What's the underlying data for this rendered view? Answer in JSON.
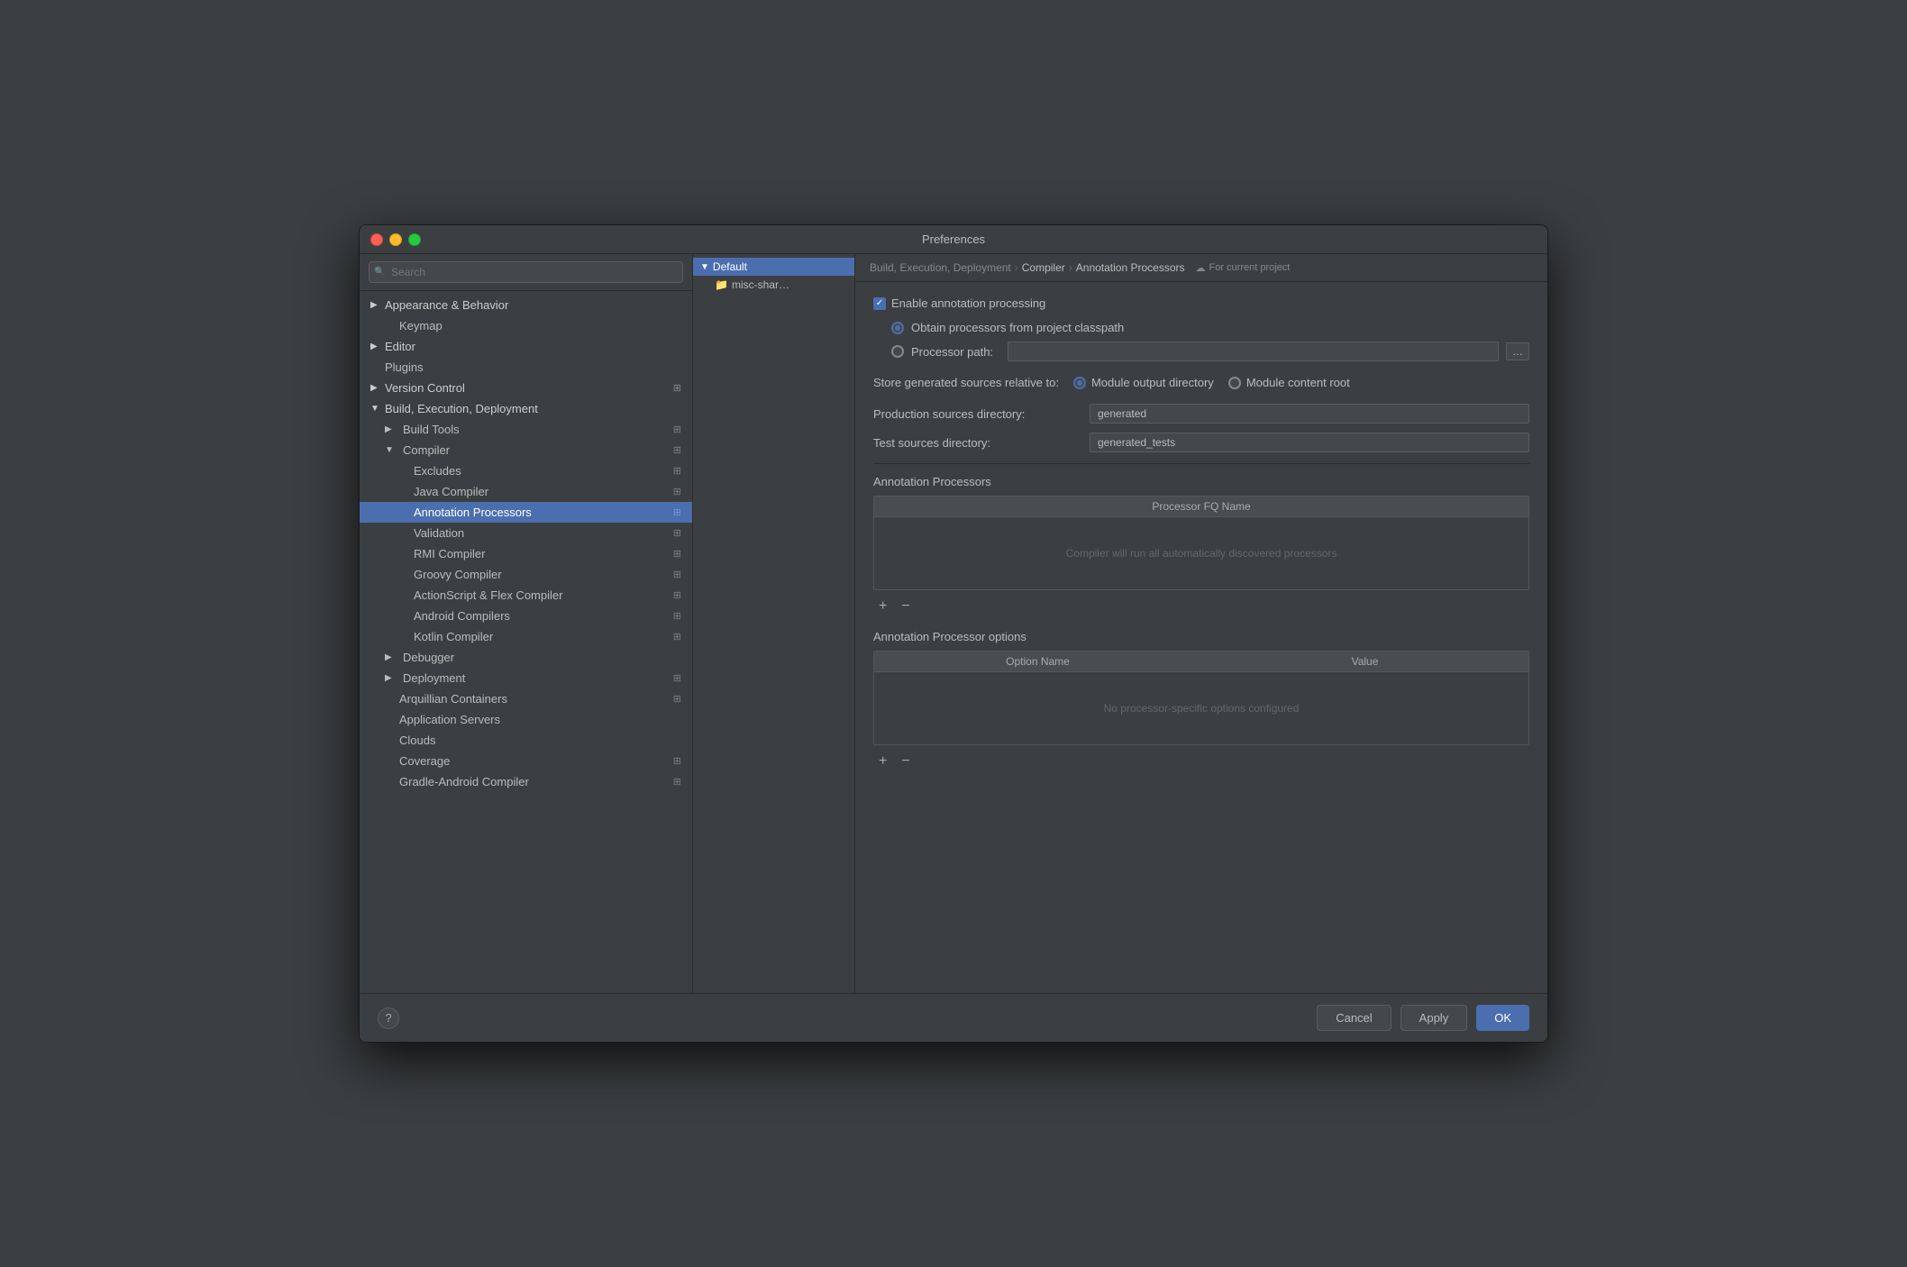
{
  "window": {
    "title": "Preferences"
  },
  "sidebar": {
    "search_placeholder": "Search",
    "items": [
      {
        "id": "appearance-behavior",
        "label": "Appearance & Behavior",
        "indent": 0,
        "arrow": "▶",
        "has_arrow": true,
        "active": false
      },
      {
        "id": "keymap",
        "label": "Keymap",
        "indent": 1,
        "has_arrow": false,
        "active": false
      },
      {
        "id": "editor",
        "label": "Editor",
        "indent": 0,
        "arrow": "▶",
        "has_arrow": true,
        "active": false
      },
      {
        "id": "plugins",
        "label": "Plugins",
        "indent": 0,
        "has_arrow": false,
        "active": false
      },
      {
        "id": "version-control",
        "label": "Version Control",
        "indent": 0,
        "arrow": "▶",
        "has_arrow": true,
        "active": false
      },
      {
        "id": "build-execution-deployment",
        "label": "Build, Execution, Deployment",
        "indent": 0,
        "arrow": "▼",
        "has_arrow": true,
        "active": false
      },
      {
        "id": "build-tools",
        "label": "Build Tools",
        "indent": 1,
        "arrow": "▶",
        "has_arrow": true,
        "active": false
      },
      {
        "id": "compiler",
        "label": "Compiler",
        "indent": 1,
        "arrow": "▼",
        "has_arrow": true,
        "active": false
      },
      {
        "id": "excludes",
        "label": "Excludes",
        "indent": 2,
        "has_arrow": false,
        "active": false
      },
      {
        "id": "java-compiler",
        "label": "Java Compiler",
        "indent": 2,
        "has_arrow": false,
        "active": false
      },
      {
        "id": "annotation-processors",
        "label": "Annotation Processors",
        "indent": 2,
        "has_arrow": false,
        "active": true
      },
      {
        "id": "validation",
        "label": "Validation",
        "indent": 2,
        "has_arrow": false,
        "active": false
      },
      {
        "id": "rmi-compiler",
        "label": "RMI Compiler",
        "indent": 2,
        "has_arrow": false,
        "active": false
      },
      {
        "id": "groovy-compiler",
        "label": "Groovy Compiler",
        "indent": 2,
        "has_arrow": false,
        "active": false
      },
      {
        "id": "actionscript-flex-compiler",
        "label": "ActionScript & Flex Compiler",
        "indent": 2,
        "has_arrow": false,
        "active": false
      },
      {
        "id": "android-compilers",
        "label": "Android Compilers",
        "indent": 2,
        "has_arrow": false,
        "active": false
      },
      {
        "id": "kotlin-compiler",
        "label": "Kotlin Compiler",
        "indent": 2,
        "has_arrow": false,
        "active": false
      },
      {
        "id": "debugger",
        "label": "Debugger",
        "indent": 1,
        "arrow": "▶",
        "has_arrow": true,
        "active": false
      },
      {
        "id": "deployment",
        "label": "Deployment",
        "indent": 1,
        "arrow": "▶",
        "has_arrow": true,
        "active": false
      },
      {
        "id": "arquillian-containers",
        "label": "Arquillian Containers",
        "indent": 1,
        "has_arrow": false,
        "active": false
      },
      {
        "id": "application-servers",
        "label": "Application Servers",
        "indent": 1,
        "has_arrow": false,
        "active": false
      },
      {
        "id": "clouds",
        "label": "Clouds",
        "indent": 1,
        "has_arrow": false,
        "active": false
      },
      {
        "id": "coverage",
        "label": "Coverage",
        "indent": 1,
        "has_arrow": false,
        "active": false
      },
      {
        "id": "gradle-android-compiler",
        "label": "Gradle-Android Compiler",
        "indent": 1,
        "has_arrow": false,
        "active": false
      }
    ]
  },
  "tree": {
    "items": [
      {
        "id": "default",
        "label": "Default",
        "is_folder": false,
        "arrow": "▼",
        "active": true
      },
      {
        "id": "misc-share",
        "label": "misc-shar…",
        "is_folder": true,
        "active": false
      }
    ]
  },
  "breadcrumb": {
    "parts": [
      "Build, Execution, Deployment",
      "›",
      "Compiler",
      "›",
      "Annotation Processors",
      "☁",
      "For current project"
    ]
  },
  "main": {
    "enable_annotation_processing": {
      "label": "Enable annotation processing",
      "checked": true
    },
    "processor_source": {
      "option1_label": "Obtain processors from project classpath",
      "option1_selected": true,
      "option2_label": "Processor path:",
      "option2_selected": false,
      "processor_path_value": "",
      "processor_path_placeholder": ""
    },
    "store_generated": {
      "label": "Store generated sources relative to:",
      "option1": "Module output directory",
      "option1_selected": true,
      "option2": "Module content root",
      "option2_selected": false
    },
    "production_sources_dir": {
      "label": "Production sources directory:",
      "value": "generated"
    },
    "test_sources_dir": {
      "label": "Test sources directory:",
      "value": "generated_tests"
    },
    "annotation_processors_section": {
      "title": "Annotation Processors",
      "table_header": "Processor FQ Name",
      "empty_message": "Compiler will run all automatically discovered processors"
    },
    "annotation_processor_options_section": {
      "title": "Annotation Processor options",
      "col1": "Option Name",
      "col2": "Value",
      "empty_message": "No processor-specific options configured"
    }
  },
  "footer": {
    "cancel_label": "Cancel",
    "apply_label": "Apply",
    "ok_label": "OK"
  }
}
